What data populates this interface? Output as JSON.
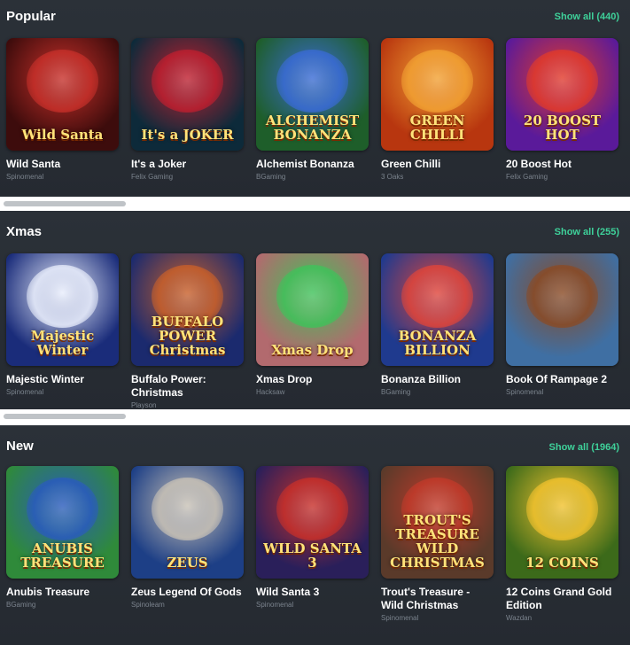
{
  "sections": [
    {
      "title": "Popular",
      "show_all": "Show all (440)",
      "games": [
        {
          "name": "Wild Santa",
          "provider": "Spinomenal",
          "thumb_text": "Wild Santa",
          "bg": "#3d0c0c",
          "accent": "#c8302a"
        },
        {
          "name": "It's a Joker",
          "provider": "Felix Gaming",
          "thumb_text": "It's a JOKER",
          "bg": "#0d2a3a",
          "accent": "#c01f2f"
        },
        {
          "name": "Alchemist Bonanza",
          "provider": "BGaming",
          "thumb_text": "ALCHEMIST BONANZA",
          "bg": "#1e5e2a",
          "accent": "#3a6bd6"
        },
        {
          "name": "Green Chilli",
          "provider": "3 Oaks",
          "thumb_text": "GREEN CHILLI",
          "bg": "#b8360f",
          "accent": "#f2a233"
        },
        {
          "name": "20 Boost Hot",
          "provider": "Felix Gaming",
          "thumb_text": "20 BOOST HOT",
          "bg": "#5a1a9a",
          "accent": "#e23a2a"
        }
      ]
    },
    {
      "title": "Xmas",
      "show_all": "Show all (255)",
      "games": [
        {
          "name": "Majestic Winter",
          "provider": "Spinomenal",
          "thumb_text": "Majestic Winter",
          "bg": "#1a2c7a",
          "accent": "#e9eefc"
        },
        {
          "name": "Buffalo Power: Christmas",
          "provider": "Playson",
          "thumb_text": "BUFFALO POWER Christmas",
          "bg": "#1b2a6e",
          "accent": "#c9602a"
        },
        {
          "name": "Xmas Drop",
          "provider": "Hacksaw",
          "thumb_text": "Xmas Drop",
          "bg": "#b26a6e",
          "accent": "#3fc25a"
        },
        {
          "name": "Bonanza Billion",
          "provider": "BGaming",
          "thumb_text": "BONANZA BILLION",
          "bg": "#1f3a8e",
          "accent": "#e0453a"
        },
        {
          "name": "Book Of Rampage 2",
          "provider": "Spinomenal",
          "thumb_text": "",
          "bg": "#3f6fa3",
          "accent": "#8a4a24"
        }
      ]
    },
    {
      "title": "New",
      "show_all": "Show all (1964)",
      "games": [
        {
          "name": "Anubis Treasure",
          "provider": "BGaming",
          "thumb_text": "ANUBIS TREASURE",
          "bg": "#2f8a3a",
          "accent": "#2a5bbd"
        },
        {
          "name": "Zeus Legend Of Gods",
          "provider": "Spinoleam",
          "thumb_text": "ZEUS",
          "bg": "#1d3f86",
          "accent": "#c9c2b6"
        },
        {
          "name": "Wild Santa 3",
          "provider": "Spinomenal",
          "thumb_text": "WILD SANTA 3",
          "bg": "#2a1f5a",
          "accent": "#c8302a"
        },
        {
          "name": "Trout's Treasure - Wild Christmas",
          "provider": "Spinomenal",
          "thumb_text": "TROUT'S TREASURE WILD CHRISTMAS",
          "bg": "#5a3a2a",
          "accent": "#c23a2a"
        },
        {
          "name": "12 Coins Grand Gold Edition",
          "provider": "Wazdan",
          "thumb_text": "12 COINS",
          "bg": "#3c6a1a",
          "accent": "#f2c22e"
        }
      ]
    }
  ]
}
